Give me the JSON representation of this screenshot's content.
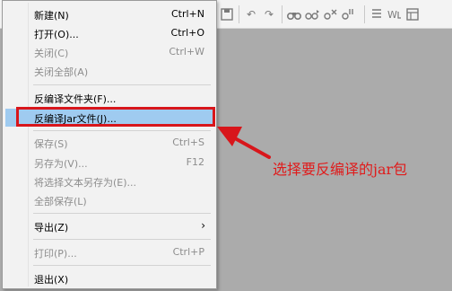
{
  "menu": {
    "items": [
      {
        "label": "新建(N)",
        "shortcut": "Ctrl+N"
      },
      {
        "label": "打开(O)...",
        "shortcut": "Ctrl+O"
      },
      {
        "label": "关闭(C)",
        "shortcut": "Ctrl+W"
      },
      {
        "label": "关闭全部(A)",
        "shortcut": ""
      },
      {
        "label": "反编译文件夹(F)...",
        "shortcut": ""
      },
      {
        "label": "反编译Jar文件(J)...",
        "shortcut": ""
      },
      {
        "label": "保存(S)",
        "shortcut": "Ctrl+S"
      },
      {
        "label": "另存为(V)...",
        "shortcut": "F12"
      },
      {
        "label": "将选择文本另存为(E)...",
        "shortcut": ""
      },
      {
        "label": "全部保存(L)",
        "shortcut": ""
      },
      {
        "label": "导出(Z)",
        "shortcut": ""
      },
      {
        "label": "打印(P)...",
        "shortcut": "Ctrl+P"
      },
      {
        "label": "退出(X)",
        "shortcut": ""
      }
    ],
    "submenu_arrow": "›"
  },
  "toolbar": {
    "icons": [
      "save-icon",
      "undo-icon",
      "redo-icon",
      "find-icon",
      "find-next-icon",
      "replace-icon",
      "replace-all-icon",
      "format-icon",
      "word-wrap-icon",
      "view-icon"
    ]
  },
  "annotation": {
    "callout_text": "选择要反编译的jar包",
    "color": "#e01b1b"
  },
  "colors": {
    "highlight": "#9fcbf0",
    "workspace": "#ababab",
    "disabled_text": "#8d8d8d"
  }
}
